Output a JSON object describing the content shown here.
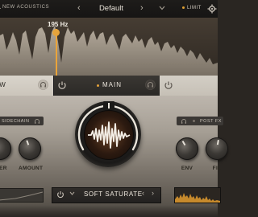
{
  "header": {
    "brand": "NEW ACOUSTICS",
    "preset_prev": "‹",
    "preset_name": "Default",
    "preset_next": "›",
    "preset_menu_icon": "chevron-down",
    "limit_label": "LIMIT",
    "limit_indicator_color": "#e0a032"
  },
  "spectrum": {
    "frequency_label": "195 Hz",
    "marker_color": "#eaa43a"
  },
  "bands": {
    "low_label": "OW",
    "main_label": "MAIN",
    "main_indicator_color": "#e3a23a"
  },
  "panel": {
    "sidechain_label": "SIDECHAIN",
    "postfx_label": "POST FX",
    "knobs": {
      "drive": "ER",
      "amount": "AMOUNT",
      "env": "ENV",
      "filter": "FIL"
    }
  },
  "algorithm": {
    "menu_icon": "chevron-down",
    "name": "SOFT SATURATE",
    "prev": "‹",
    "next": "›"
  },
  "colors": {
    "accent": "#e6a43c",
    "background": "#2a2622"
  }
}
